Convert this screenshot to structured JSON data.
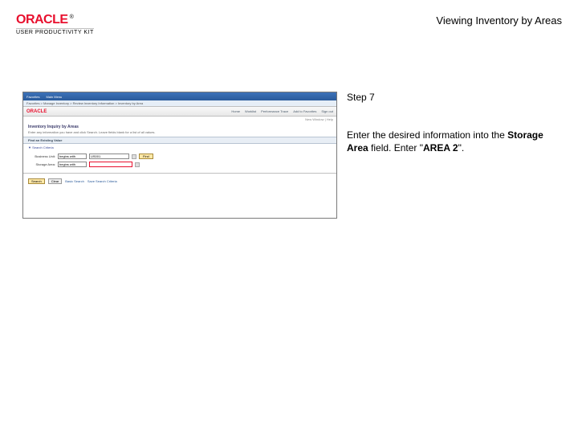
{
  "header": {
    "brand": "ORACLE",
    "tm": "®",
    "subtitle": "USER PRODUCTIVITY KIT",
    "page_title": "Viewing Inventory by Areas"
  },
  "instruction": {
    "step_label": "Step 7",
    "text_before": "Enter the desired information into the ",
    "field_label": "Storage Area",
    "text_mid": " field. Enter \"",
    "value": "AREA 2",
    "text_after": "\"."
  },
  "app": {
    "menubar": [
      "Favorites",
      "Main Menu"
    ],
    "breadcrumb": "Favorites > Manage Inventory > Review Inventory Information > Inventory by Area",
    "brand": "ORACLE",
    "nav": [
      "Home",
      "Worklist",
      "Performance Trace",
      "Add to Favorites",
      "Sign out"
    ],
    "user_line": "New Window | Help",
    "page_h1": "Inventory Inquiry by Areas",
    "page_desc": "Enter any information you have and click Search. Leave fields blank for a list of all values.",
    "find_header": "Find an Existing Value",
    "search_criteria": "Search Criteria",
    "fields": {
      "business_unit_label": "Business Unit:",
      "business_unit_op": "begins with",
      "business_unit_value": "US001",
      "storage_area_label": "Storage Area:",
      "storage_area_op": "begins with",
      "storage_area_value": ""
    },
    "find_btn": "Find",
    "footer": {
      "search": "Search",
      "clear": "Clear",
      "basic": "Basic Search",
      "save": "Save Search Criteria"
    }
  }
}
